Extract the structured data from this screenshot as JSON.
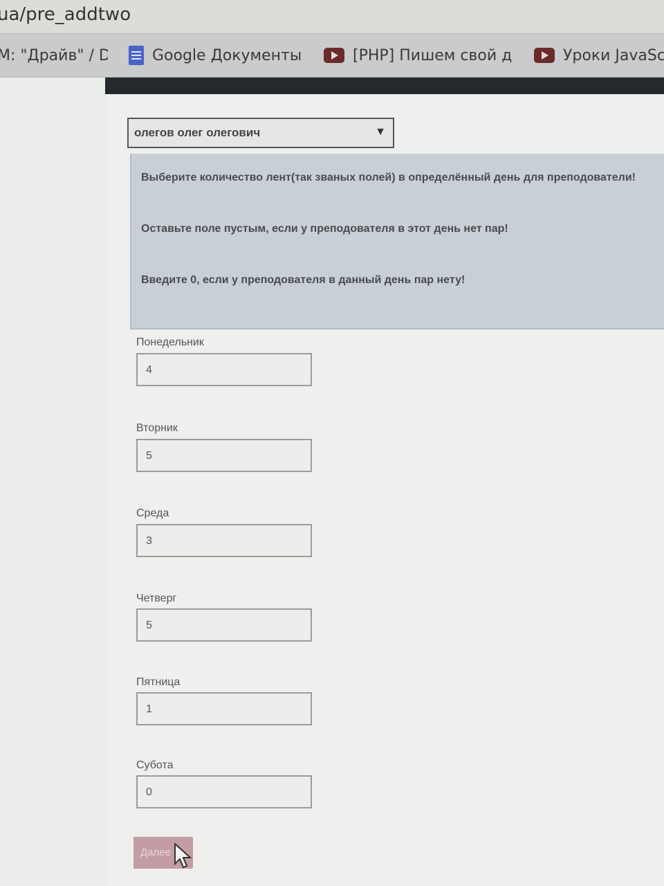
{
  "browser": {
    "url": "ua/pre_addtwo",
    "bookmarks": [
      {
        "label": "М: \"Драйв\" / D",
        "icon": "none"
      },
      {
        "label": "Google Документы",
        "icon": "google-docs-icon"
      },
      {
        "label": "[PHP] Пишем свой д",
        "icon": "youtube-icon"
      },
      {
        "label": "Уроки JavaSc",
        "icon": "youtube-icon"
      }
    ]
  },
  "form": {
    "teacher_select": "олегов олег олегович",
    "info": [
      "Выберите количество лент(так званых полей) в определённый день для преподователи!",
      "Оставьте поле пустым, если у преподователя в этот день нет пар!",
      "Введите 0, если у преподователя в данный день пар нету!"
    ],
    "days": [
      {
        "label": "Понедельник",
        "value": "4"
      },
      {
        "label": "Вторник",
        "value": "5"
      },
      {
        "label": "Среда",
        "value": "3"
      },
      {
        "label": "Четверг",
        "value": "5"
      },
      {
        "label": "Пятница",
        "value": "1"
      },
      {
        "label": "Субота",
        "value": "0"
      }
    ],
    "submit_label": "Далее"
  }
}
